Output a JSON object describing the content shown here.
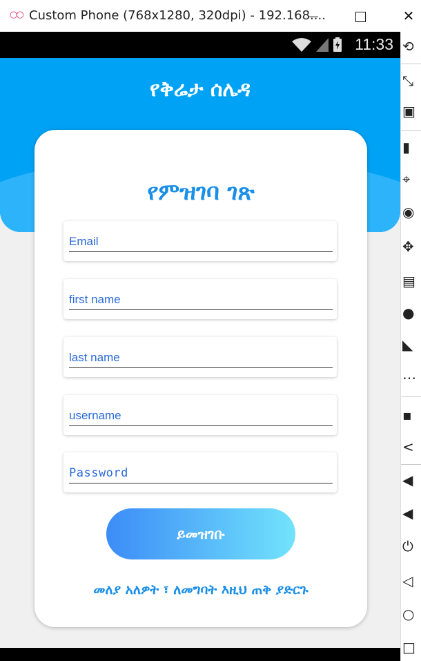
{
  "window": {
    "title": "Custom Phone (768x1280, 320dpi) - 192.168....",
    "minimize_label": "—",
    "maximize_label": "☐",
    "close_label": "✕"
  },
  "statusbar": {
    "time": "11:33"
  },
  "header": {
    "app_title": "የቅሬታ ሰሌዳ"
  },
  "form": {
    "heading": "የምዝገባ ገጽ",
    "fields": [
      {
        "placeholder": "Email"
      },
      {
        "placeholder": "first name"
      },
      {
        "placeholder": "last name"
      },
      {
        "placeholder": "username"
      },
      {
        "placeholder": "Password"
      }
    ],
    "register_label": "ይመዝገቡ",
    "login_link": "መለያ አለዎት ፣ ለመግባት እዚህ ጠቅ ያድርጉ"
  },
  "sidebar": {
    "items": [
      "rotate-icon",
      "screen-size-icon",
      "camera-icon",
      "battery-icon",
      "gps-icon",
      "webcam-icon",
      "move-icon",
      "id-icon",
      "disk-icon",
      "rss-icon",
      "more-icon",
      "opengapps-icon",
      "share-icon",
      "volume-down-icon",
      "volume-up-icon",
      "power-icon",
      "back-icon",
      "home-icon",
      "recents-icon"
    ]
  },
  "colors": {
    "header": "#00a2f5",
    "accent": "#1a8fe8",
    "input_text": "#2a6ad8",
    "button_start": "#3c8cf7",
    "button_end": "#72e3fb"
  }
}
